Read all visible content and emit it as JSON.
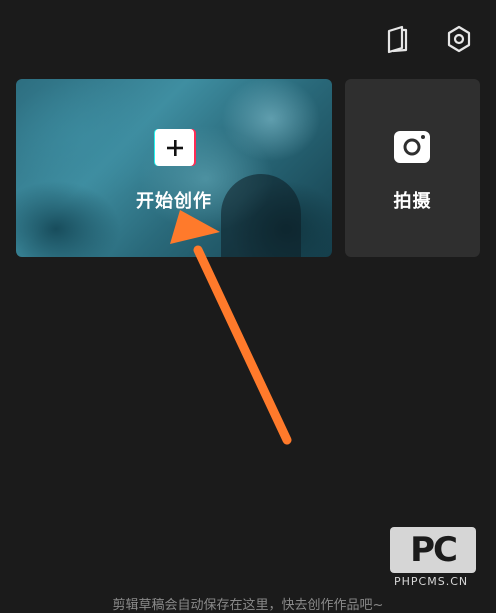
{
  "topbar": {
    "book_icon": "book-icon",
    "settings_icon": "settings-hexagon-icon"
  },
  "start_card": {
    "label": "开始创作",
    "icon": "plus-icon",
    "accent_colors": [
      "#25f4ee",
      "#fe2c55"
    ]
  },
  "shoot_card": {
    "label": "拍摄",
    "icon": "camera-icon"
  },
  "annotation": {
    "arrow_color": "#ff7a2b"
  },
  "watermark": {
    "logo_text": "PC",
    "site_text": "PHPCMS.CN"
  },
  "footer": {
    "hint": "剪辑草稿会自动保存在这里，快去创作作品吧~"
  }
}
